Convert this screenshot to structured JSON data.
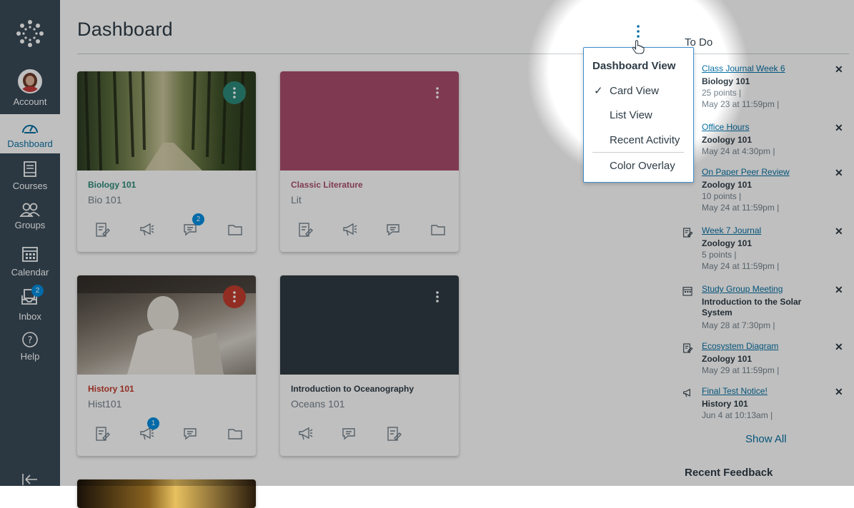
{
  "nav": {
    "items": [
      {
        "label": "Account",
        "icon": "avatar"
      },
      {
        "label": "Dashboard",
        "icon": "speedometer-icon"
      },
      {
        "label": "Courses",
        "icon": "book-icon"
      },
      {
        "label": "Groups",
        "icon": "people-icon"
      },
      {
        "label": "Calendar",
        "icon": "calendar-icon"
      },
      {
        "label": "Inbox",
        "icon": "inbox-icon",
        "badge": "2"
      },
      {
        "label": "Help",
        "icon": "help-icon"
      }
    ]
  },
  "header": {
    "title": "Dashboard"
  },
  "dashboard_menu": {
    "heading": "Dashboard View",
    "options": [
      "Card View",
      "List View",
      "Recent Activity"
    ],
    "selected": "Card View",
    "extra": "Color Overlay"
  },
  "cards": [
    {
      "name": "Biology 101",
      "code": "Bio 101",
      "color": "#2c8a7a",
      "hero": "forest-photo",
      "discussion_badge": "2"
    },
    {
      "name": "Classic Literature",
      "code": "Lit",
      "color": "#a94d6e",
      "hero": "solid-color"
    },
    {
      "name": "History 101",
      "code": "Hist101",
      "color": "#c23c2d",
      "hero": "lincoln-memorial-photo",
      "announcement_badge": "1"
    },
    {
      "name": "Introduction to Oceanography",
      "code": "Oceans 101",
      "color": "#2f3b43",
      "hero": "solid-color"
    }
  ],
  "todo": {
    "title": "To Do",
    "items": [
      {
        "title": "Class Journal Week 6",
        "course": "Biology 101",
        "points": "25 points  |",
        "due": "May 23 at 11:59pm  |",
        "icon": "assignment-icon"
      },
      {
        "title": "Office Hours",
        "course": "Zoology 101",
        "due": "May 24 at 4:30pm  |",
        "icon": "calendar-icon"
      },
      {
        "title": "On Paper Peer Review",
        "course": "Zoology 101",
        "points": "10 points  |",
        "due": "May 24 at 11:59pm  |",
        "icon": "assignment-icon"
      },
      {
        "title": "Week 7 Journal",
        "course": "Zoology 101",
        "points": "5 points  |",
        "due": "May 24 at 11:59pm  |",
        "icon": "assignment-icon"
      },
      {
        "title": "Study Group Meeting",
        "course": "Introduction to the Solar System",
        "due": "May 28 at 7:30pm  |",
        "icon": "calendar-icon"
      },
      {
        "title": "Ecosystem Diagram",
        "course": "Zoology 101",
        "due": "May 29 at 11:59pm  |",
        "icon": "assignment-icon"
      },
      {
        "title": "Final Test Notice!",
        "course": "History 101",
        "due": "Jun 4 at 10:13am  |",
        "icon": "announcement-icon"
      }
    ],
    "show_all": "Show All",
    "dismiss_glyph": "✕"
  },
  "recent_feedback": {
    "title": "Recent Feedback"
  },
  "colors": {
    "nav_bg": "#394b58",
    "link": "#0770a3",
    "badge": "#008ee2",
    "menu_border": "#3d8fd1"
  }
}
